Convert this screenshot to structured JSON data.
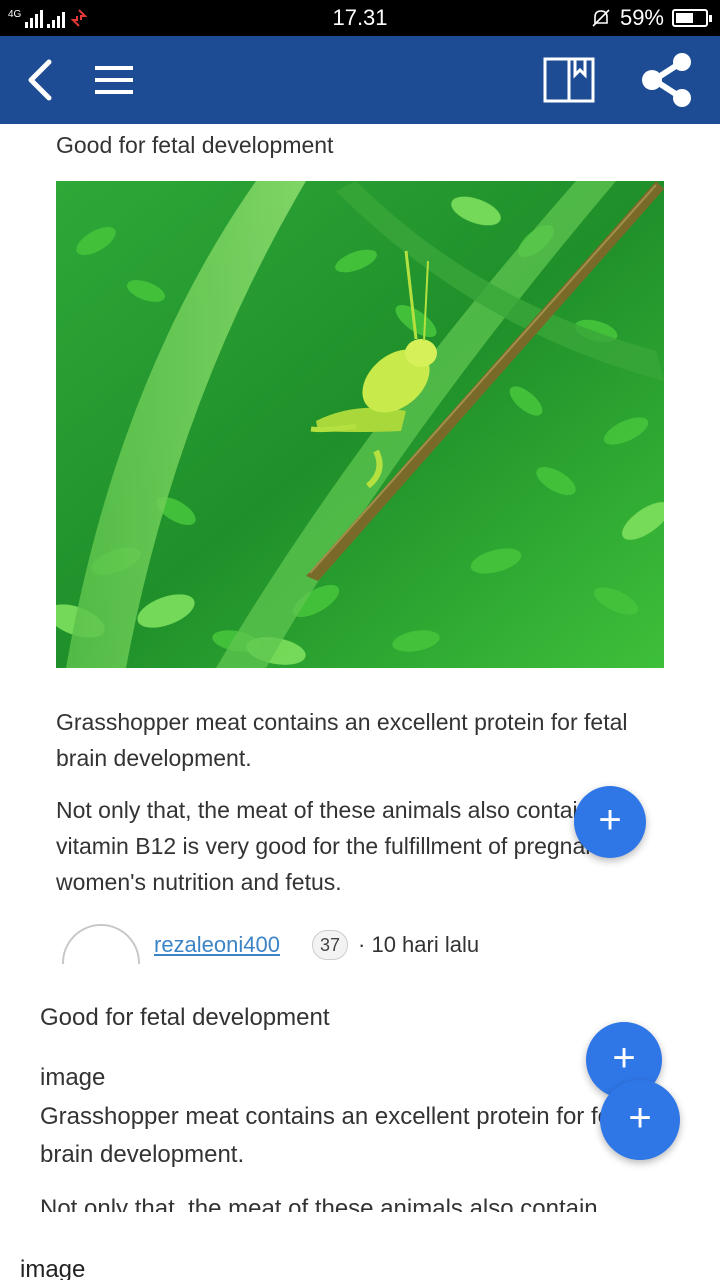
{
  "status_bar": {
    "network": "4G",
    "time": "17.31",
    "battery": "59%",
    "battery_level": 0.59
  },
  "app_bar": {
    "back_icon": "arrow-back-icon",
    "menu_icon": "hamburger-menu-icon",
    "read_icon": "book-icon",
    "share_icon": "share-icon"
  },
  "article": {
    "heading": "Good for fetal development",
    "paragraph1": "Grasshopper meat contains an excellent protein for fetal brain development.",
    "paragraph2": "Not only that, the meat of these animals also contain vitamin B12 is very good for the fulfillment of pregnant women's nutrition and fetus.",
    "author": {
      "username": "rezaleoni400",
      "reputation": "37",
      "separator": "·",
      "time": "10 hari lalu"
    }
  },
  "snippet": {
    "title": "Good for fetal development",
    "image_label": "image",
    "paragraph1": "Grasshopper meat contains an excellent protein for fetal brain development.",
    "paragraph2": "Not only that, the meat of these animals also contain"
  },
  "bottom": {
    "image_label": "image"
  },
  "fab": {
    "label": "+",
    "color": "#2f76e6"
  },
  "colors": {
    "app_bar": "#1d4c94",
    "link": "#3d84c6"
  }
}
